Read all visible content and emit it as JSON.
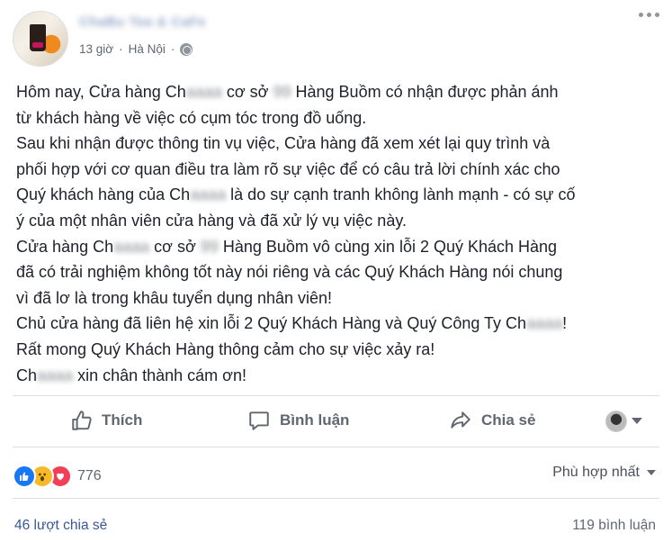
{
  "post": {
    "page_name": "ChaBu Tea & CaFe",
    "meta": {
      "time": "13 giờ",
      "separator": "·",
      "location": "Hà Nội",
      "separator2": "·"
    },
    "lines": [
      {
        "parts": [
          "Hôm nay, Cửa hàng Ch",
          "aaaa",
          " cơ sở ",
          "99",
          " Hàng Buồm có nhận được phản ánh"
        ]
      },
      {
        "parts": [
          "từ khách hàng về việc có cụm tóc trong đồ uống."
        ]
      },
      {
        "parts": [
          "Sau khi nhận được thông tin vụ việc, Cửa hàng đã xem xét lại quy trình và"
        ]
      },
      {
        "parts": [
          "phối hợp với cơ quan điều tra làm rõ sự việc để có câu trả lời chính xác cho"
        ]
      },
      {
        "parts": [
          "Quý khách hàng của Ch",
          "aaaa",
          " là do sự cạnh tranh không lành mạnh - có sự cố"
        ]
      },
      {
        "parts": [
          "ý của một nhân viên cửa hàng và đã xử lý vụ việc này."
        ]
      },
      {
        "parts": [
          "Cửa hàng Ch",
          "aaaa",
          " cơ sở ",
          "99",
          " Hàng Buồm vô cùng xin lỗi 2 Quý Khách Hàng"
        ]
      },
      {
        "parts": [
          "đã có trải nghiệm không tốt này nói riêng và các Quý Khách Hàng nói chung"
        ]
      },
      {
        "parts": [
          "vì đã lơ là trong khâu tuyển dụng nhân viên!"
        ]
      },
      {
        "parts": [
          "Chủ cửa hàng đã liên hệ xin lỗi 2 Quý Khách Hàng và Quý Công Ty Ch",
          "aaaa",
          "!"
        ]
      },
      {
        "parts": [
          "Rất mong Quý Khách Hàng thông cảm cho sự việc xảy ra!"
        ]
      },
      {
        "parts": [
          "Ch",
          "aaaa",
          " xin chân thành cám ơn!"
        ]
      }
    ]
  },
  "actions": {
    "like": "Thích",
    "comment": "Bình luận",
    "share": "Chia sẻ"
  },
  "reactions": {
    "count": "776",
    "sort_label": "Phù hợp nhất"
  },
  "footer": {
    "shares": "46 lượt chia sẻ",
    "comments": "119 bình luận"
  }
}
